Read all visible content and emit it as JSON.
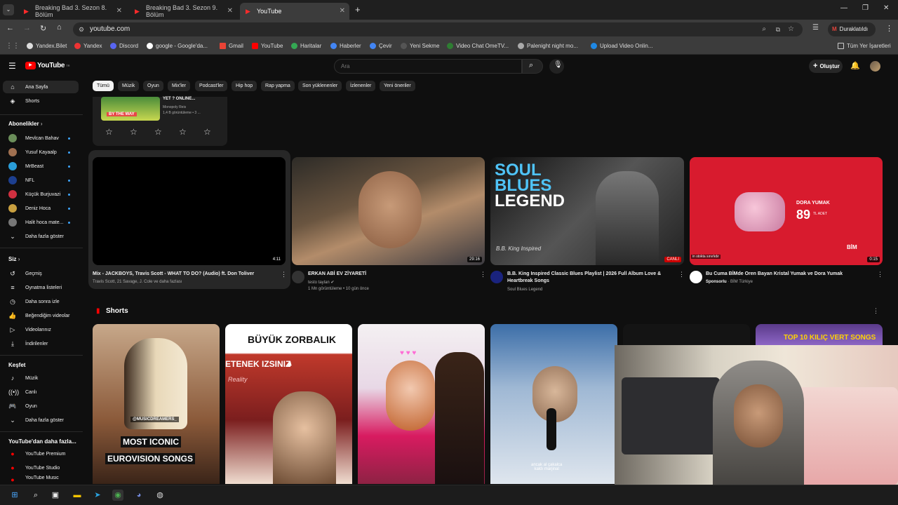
{
  "browser": {
    "tabs": [
      {
        "label": "Breaking Bad 3. Sezon 8. Bölüm"
      },
      {
        "label": "Breaking Bad 3. Sezon 9. Bölüm"
      },
      {
        "label": "YouTube"
      }
    ],
    "url": "youtube.com",
    "paused_label": "Duraklatıldı",
    "profile_initial": "M",
    "bookmarks": [
      "Yandex.Bilet",
      "Yandex",
      "Discord",
      "google - Google'da...",
      "Gmail",
      "YouTube",
      "Haritalar",
      "Haberler",
      "Çevir",
      "Yeni Sekme",
      "Video Chat OmeTV...",
      "Palenight night mo...",
      "Upload Video Onlin..."
    ],
    "all_bookmarks": "Tüm Yer İşaretleri"
  },
  "youtube": {
    "logo": "YouTube",
    "logo_region": "TR",
    "search_placeholder": "Ara",
    "create_label": "Oluştur",
    "chips": [
      "Tümü",
      "Müzik",
      "Oyun",
      "Mix'ler",
      "Podcast'ler",
      "Hip hop",
      "Rap yapma",
      "Son yüklenenler",
      "İzlenenler",
      "Yeni öneriler"
    ]
  },
  "sidebar": {
    "main": [
      {
        "label": "Ana Sayfa",
        "icon": "home-icon"
      },
      {
        "label": "Shorts",
        "icon": "shorts-icon"
      }
    ],
    "subs_head": "Abonelikler",
    "subs": [
      {
        "label": "Mevlcan Bahav",
        "color": "#6b8e5a"
      },
      {
        "label": "Yusuf Kayaalp",
        "color": "#a07050"
      },
      {
        "label": "MrBeast",
        "color": "#2a9dd8"
      },
      {
        "label": "NFL",
        "color": "#1d3f8f"
      },
      {
        "label": "Küçük Burjuvazi",
        "color": "#d03040"
      },
      {
        "label": "Deniz Hoca",
        "color": "#c9a040"
      },
      {
        "label": "Halit hoca mate...",
        "color": "#777777"
      }
    ],
    "show_more": "Daha fazla göster",
    "you_head": "Siz",
    "you": [
      {
        "label": "Geçmiş",
        "icon": "history-icon"
      },
      {
        "label": "Oynatma listeleri",
        "icon": "playlist-icon"
      },
      {
        "label": "Daha sonra izle",
        "icon": "clock-icon"
      },
      {
        "label": "Beğendiğim videolar",
        "icon": "like-icon"
      },
      {
        "label": "Videolarınız",
        "icon": "video-icon"
      },
      {
        "label": "İndirilenler",
        "icon": "download-icon"
      }
    ],
    "explore_head": "Keşfet",
    "explore": [
      {
        "label": "Müzik",
        "icon": "music-icon"
      },
      {
        "label": "Canlı",
        "icon": "live-icon"
      },
      {
        "label": "Oyun",
        "icon": "gaming-icon"
      }
    ],
    "show_more2": "Daha fazla göster",
    "more_head": "YouTube'dan daha fazla...",
    "more": [
      {
        "label": "YouTube Premium"
      },
      {
        "label": "YouTube Studio"
      },
      {
        "label": "YouTube Music"
      }
    ]
  },
  "survey_card": {
    "title": "YET ? ONLINE...",
    "channel": "Monopoly Reis",
    "meta": "1,4 B görüntüleme • 3 ...",
    "thumb_text": "BY THE WAY"
  },
  "videos": [
    {
      "title": "Mix - JACKBOYS, Travis Scott - WHAT TO DO? (Audio) ft. Don Toliver",
      "meta": "Travis Scott, 21 Savage, J. Cole ve daha fazlası",
      "duration": "4:11"
    },
    {
      "title": "ERKAN ABİ EV ZİYARETİ",
      "channel": "testo taylan",
      "meta": "1 Mn görüntüleme • 10 gün önce",
      "duration": "29:16"
    },
    {
      "title": "B.B. King Inspired Classic Blues Playlist | 2026 Full Album Love & Heartbreak Songs",
      "channel": "Soul Blues Legend",
      "duration": "",
      "live": "CANLI",
      "thumb_lines": [
        "SOUL",
        "BLUES",
        "LEGEND"
      ],
      "thumb_sub": "B.B. King Inspired"
    },
    {
      "title": "Bu Cuma BİMde Oren Bayan Kristal Yumak ve Dora Yumak",
      "sponsor": "Sponsorlu",
      "channel": "BİM Türkiye",
      "duration": "0:15",
      "thumb_brand": "DORA YUMAK",
      "price": "89",
      "price_note": "TL ADET",
      "store": "BİM",
      "overlay": "in stokta sınırlıdır"
    }
  ],
  "shorts": {
    "heading": "Shorts",
    "items": [
      {
        "caption_handle": "@MUSICDREAMERS_",
        "caption1": "MOST ICONIC",
        "caption2": "EUROVISION SONGS"
      },
      {
        "caption1": "BÜYÜK ZORBALIK",
        "caption2": "ETENEK IZSINIZ",
        "caption3": "Reality"
      },
      {
        "caption1": ""
      },
      {
        "caption1": "ancak al çakalca",
        "caption2": "kaldı marjinal"
      },
      {
        "caption1": ""
      },
      {
        "caption1": "TOP 10",
        "caption2": "KILIÇ VERT SONGS"
      }
    ]
  }
}
